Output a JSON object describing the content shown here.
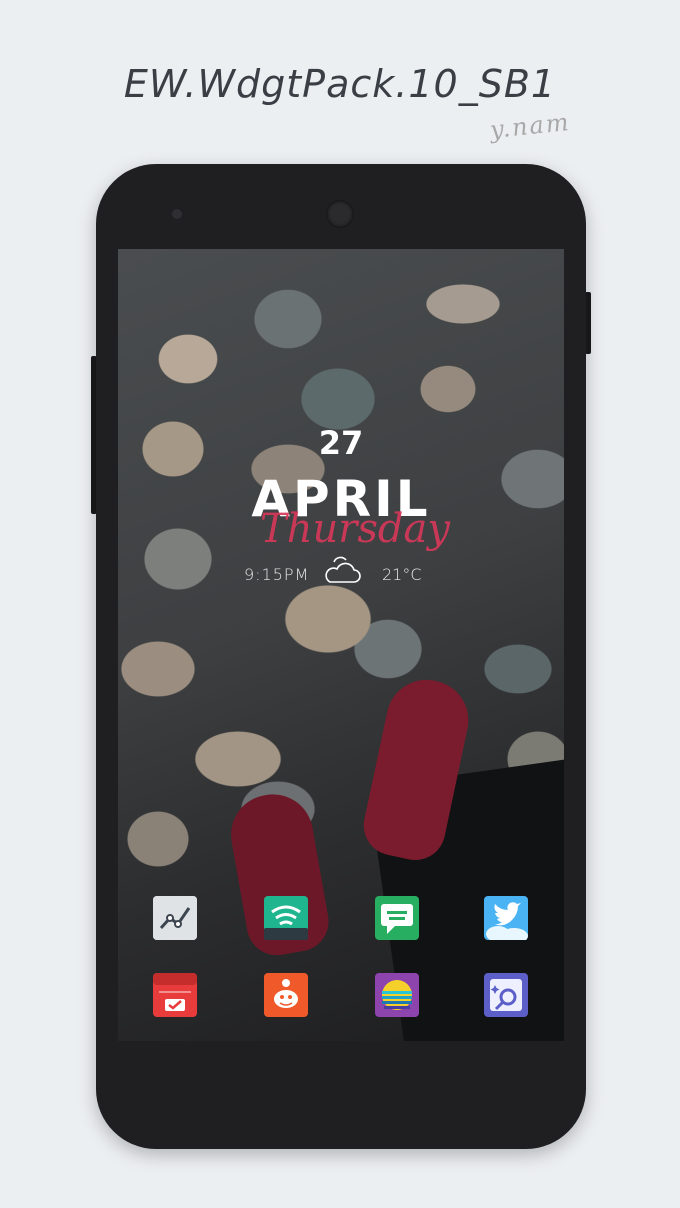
{
  "header": {
    "title": "EW.WdgtPack.10_SB1",
    "signature": "y.nam"
  },
  "widget": {
    "day": "27",
    "month": "APRIL",
    "weekday": "Thursday",
    "time": "9:15PM",
    "temperature": "21°C",
    "weather_icon": "partly-cloudy-icon"
  },
  "dock": {
    "row1": [
      {
        "name": "stats-app",
        "icon": "line-graph-icon",
        "color": "#5e6a76"
      },
      {
        "name": "hotspot-app",
        "icon": "wifi-signal-icon",
        "color": "#1fb58e"
      },
      {
        "name": "whatsapp-app",
        "icon": "chat-bubble-icon",
        "color": "#27ae60"
      },
      {
        "name": "twitter-app",
        "icon": "bird-icon",
        "color": "#4ab3f4"
      }
    ],
    "row2": [
      {
        "name": "calendar-app",
        "icon": "calendar-check-icon",
        "color": "#e83c3c"
      },
      {
        "name": "reddit-app",
        "icon": "alien-icon",
        "color": "#f05a2a"
      },
      {
        "name": "sunset-app",
        "icon": "sunset-icon",
        "color": "#8e44ad"
      },
      {
        "name": "search-app",
        "icon": "magnifier-icon",
        "color": "#5b5fc7"
      }
    ]
  }
}
